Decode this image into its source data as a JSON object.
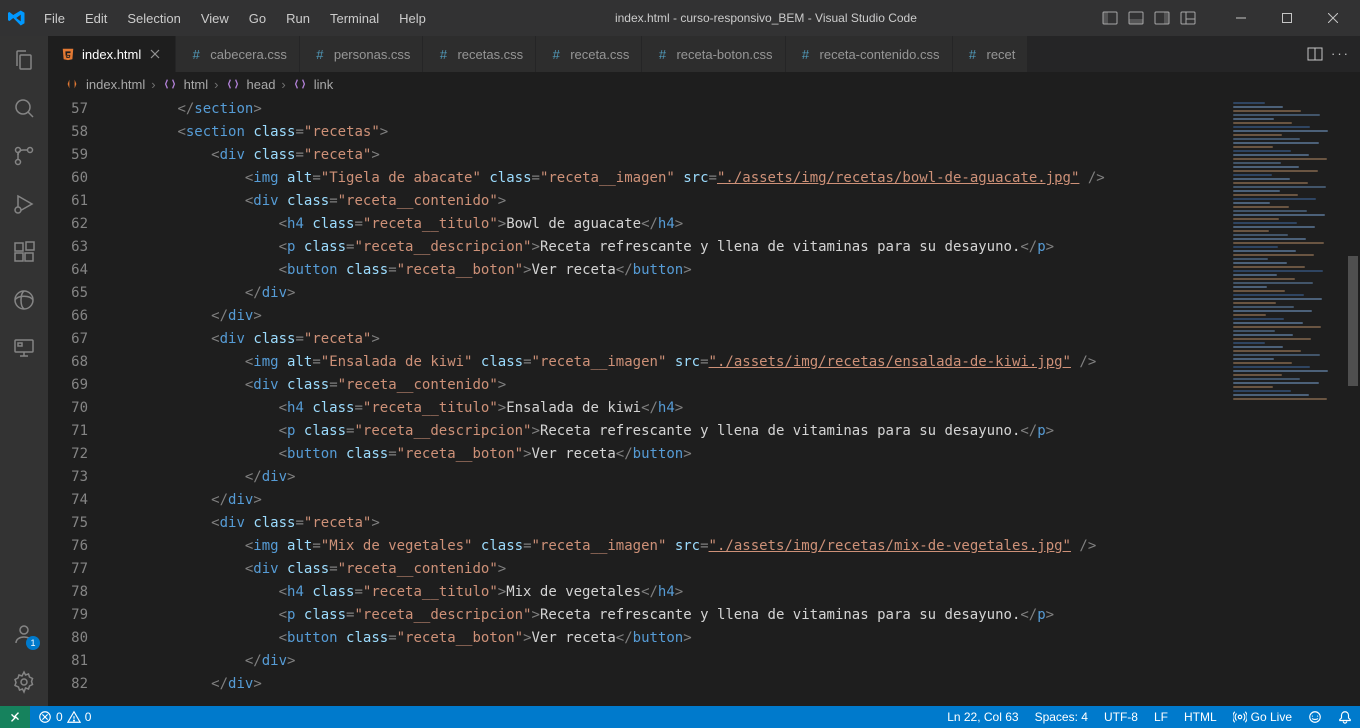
{
  "window": {
    "title": "index.html - curso-responsivo_BEM - Visual Studio Code"
  },
  "menu": [
    "File",
    "Edit",
    "Selection",
    "View",
    "Go",
    "Run",
    "Terminal",
    "Help"
  ],
  "tabs": [
    {
      "label": "index.html",
      "icon": "html",
      "active": true,
      "close": true
    },
    {
      "label": "cabecera.css",
      "icon": "css",
      "active": false
    },
    {
      "label": "personas.css",
      "icon": "css",
      "active": false
    },
    {
      "label": "recetas.css",
      "icon": "css",
      "active": false
    },
    {
      "label": "receta.css",
      "icon": "css",
      "active": false
    },
    {
      "label": "receta-boton.css",
      "icon": "css",
      "active": false
    },
    {
      "label": "receta-contenido.css",
      "icon": "css",
      "active": false
    },
    {
      "label": "recet",
      "icon": "css",
      "active": false,
      "truncated": true
    }
  ],
  "breadcrumbs": [
    {
      "icon": "html",
      "label": "index.html"
    },
    {
      "icon": "brackets",
      "label": "html"
    },
    {
      "icon": "brackets",
      "label": "head"
    },
    {
      "icon": "brackets",
      "label": "link"
    }
  ],
  "accounts_badge": "1",
  "status": {
    "errors": "0",
    "warnings": "0",
    "cursor": "Ln 22, Col 63",
    "spaces": "Spaces: 4",
    "encoding": "UTF-8",
    "eol": "LF",
    "language": "HTML",
    "golive": "Go Live"
  },
  "lines": {
    "start": 57,
    "end": 82,
    "code": {
      "section_close": "section",
      "section_open": {
        "tag": "section",
        "attr": "class",
        "val": "recetas"
      },
      "div_receta": {
        "tag": "div",
        "attr": "class",
        "val": "receta"
      },
      "div_contenido": {
        "tag": "div",
        "attr": "class",
        "val": "receta__contenido"
      },
      "div_close": "div",
      "img1": {
        "alt": "Tigela de abacate",
        "cls": "receta__imagen",
        "src": "./assets/img/recetas/bowl-de-aguacate.jpg"
      },
      "img2": {
        "alt": "Ensalada de kiwi",
        "cls": "receta__imagen",
        "src": "./assets/img/recetas/ensalada-de-kiwi.jpg"
      },
      "img3": {
        "alt": "Mix de vegetales",
        "cls": "receta__imagen",
        "src": "./assets/img/recetas/mix-de-vegetales.jpg"
      },
      "h4_1": {
        "cls": "receta__titulo",
        "text": "Bowl de aguacate"
      },
      "h4_2": {
        "cls": "receta__titulo",
        "text": "Ensalada de kiwi"
      },
      "h4_3": {
        "cls": "receta__titulo",
        "text": "Mix de vegetales"
      },
      "p": {
        "cls": "receta__descripcion",
        "text": "Receta refrescante y llena de vitaminas para su desayuno."
      },
      "button": {
        "cls": "receta__boton",
        "text": "Ver receta"
      }
    }
  }
}
